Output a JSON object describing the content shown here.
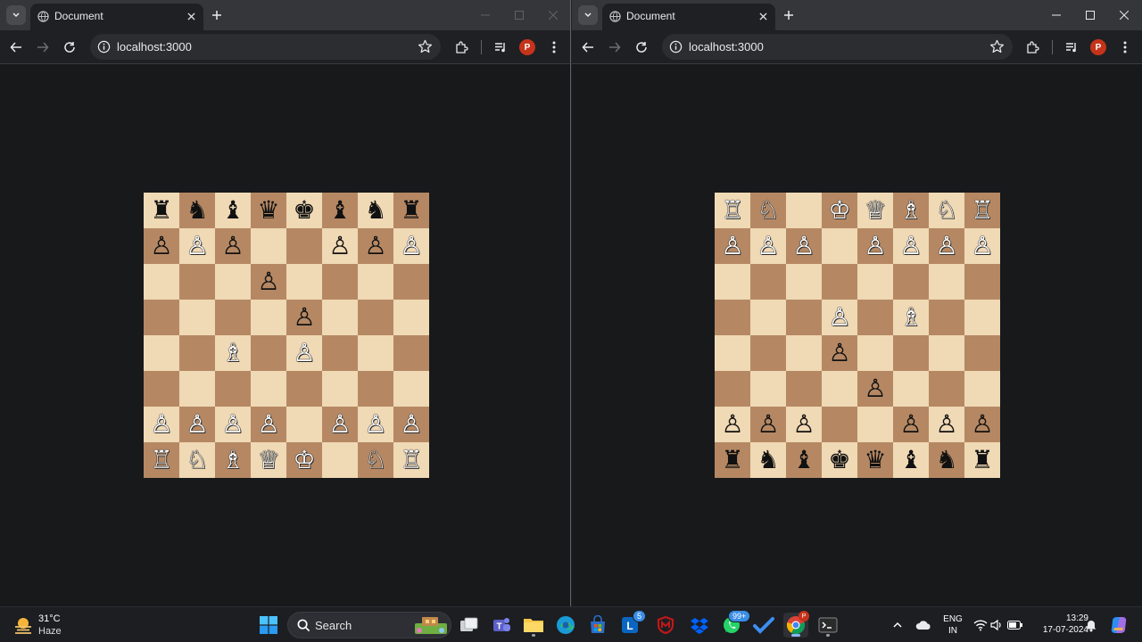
{
  "windows": [
    {
      "id": "left",
      "tab_title": "Document",
      "url": "localhost:3000",
      "profile_initial": "P",
      "board": [
        [
          "♜",
          "♞",
          "♝",
          "♛",
          "♚",
          "♝",
          "♞",
          "♜"
        ],
        [
          "♙",
          "♙",
          "♙",
          "",
          "",
          "♙",
          "♙",
          "♙"
        ],
        [
          "",
          "",
          "",
          "♙",
          "",
          "",
          "",
          ""
        ],
        [
          "",
          "",
          "",
          "",
          "♙",
          "",
          "",
          ""
        ],
        [
          "",
          "",
          "♗",
          "",
          "♙",
          "",
          "",
          ""
        ],
        [
          "",
          "",
          "",
          "",
          "",
          "",
          "",
          ""
        ],
        [
          "♙",
          "♙",
          "♙",
          "♙",
          "",
          "♙",
          "♙",
          "♙"
        ],
        [
          "♖",
          "♘",
          "♗",
          "♕",
          "♔",
          "",
          "♘",
          "♖"
        ]
      ],
      "colors": [
        [
          "b",
          "b",
          "b",
          "b",
          "b",
          "b",
          "b",
          "b"
        ],
        [
          "b",
          "w",
          "b",
          "",
          "",
          "b",
          "b",
          "w"
        ],
        [
          "",
          "",
          "",
          "b",
          "",
          "",
          "",
          ""
        ],
        [
          "",
          "",
          "",
          "",
          "b",
          "",
          "",
          ""
        ],
        [
          "",
          "",
          "w",
          "",
          "w",
          "",
          "",
          ""
        ],
        [
          "",
          "",
          "",
          "",
          "",
          "",
          "",
          ""
        ],
        [
          "w",
          "w",
          "w",
          "w",
          "",
          "w",
          "w",
          "w"
        ],
        [
          "w",
          "w",
          "w",
          "w",
          "w",
          "",
          "w",
          "w"
        ]
      ]
    },
    {
      "id": "right",
      "tab_title": "Document",
      "url": "localhost:3000",
      "profile_initial": "P",
      "board": [
        [
          "♖",
          "♘",
          "",
          "♔",
          "♕",
          "♗",
          "♘",
          "♖"
        ],
        [
          "♙",
          "♙",
          "♙",
          "",
          "♙",
          "♙",
          "♙",
          "♙"
        ],
        [
          "",
          "",
          "",
          "",
          "",
          "",
          "",
          ""
        ],
        [
          "",
          "",
          "",
          "♙",
          "",
          "♗",
          "",
          ""
        ],
        [
          "",
          "",
          "",
          "♙",
          "",
          "",
          "",
          ""
        ],
        [
          "",
          "",
          "",
          "",
          "♙",
          "",
          "",
          ""
        ],
        [
          "♙",
          "♙",
          "♙",
          "",
          "",
          "♙",
          "♙",
          "♙"
        ],
        [
          "♜",
          "♞",
          "♝",
          "♚",
          "♛",
          "♝",
          "♞",
          "♜"
        ]
      ],
      "colors": [
        [
          "w",
          "w",
          "",
          "w",
          "w",
          "w",
          "w",
          "w"
        ],
        [
          "w",
          "w",
          "w",
          "",
          "w",
          "w",
          "w",
          "w"
        ],
        [
          "",
          "",
          "",
          "",
          "",
          "",
          "",
          ""
        ],
        [
          "",
          "",
          "",
          "w",
          "",
          "w",
          "",
          ""
        ],
        [
          "",
          "",
          "",
          "b",
          "",
          "",
          "",
          ""
        ],
        [
          "",
          "",
          "",
          "",
          "b",
          "",
          "",
          ""
        ],
        [
          "b",
          "b",
          "b",
          "",
          "",
          "b",
          "b",
          "b"
        ],
        [
          "b",
          "b",
          "b",
          "b",
          "b",
          "b",
          "b",
          "b"
        ]
      ]
    }
  ],
  "taskbar": {
    "weather_temp": "31°C",
    "weather_condition": "Haze",
    "search_label": "Search",
    "badge_linkedin": "5",
    "badge_whatsapp": "99+",
    "lang_line1": "ENG",
    "lang_line2": "IN",
    "time": "13:29",
    "date": "17-07-2024",
    "chrome_profile_initial": "P"
  },
  "icons": {
    "tab_list": "chevron-down-icon",
    "close": "close-icon",
    "new_tab": "plus-icon",
    "back": "arrow-left-icon",
    "forward": "arrow-right-icon",
    "reload": "reload-icon",
    "info": "info-icon",
    "bookmark": "star-icon",
    "extensions": "puzzle-icon",
    "media": "media-control-icon",
    "menu": "kebab-menu-icon"
  },
  "colors_theme": {
    "light_square": "#f0d9b5",
    "dark_square": "#b58863",
    "page_bg": "#18191b",
    "profile": "#c5331b"
  }
}
